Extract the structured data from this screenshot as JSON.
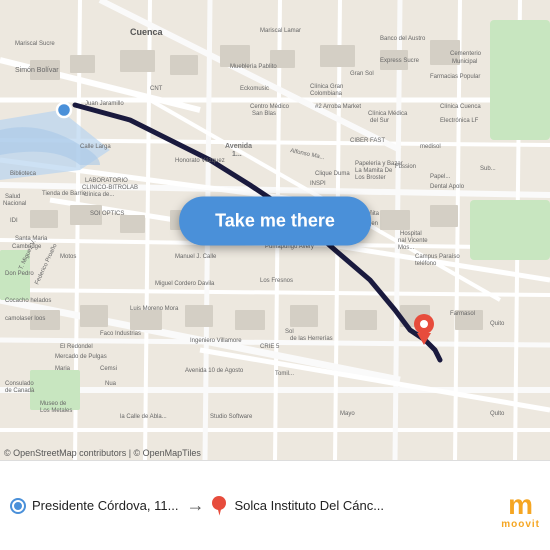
{
  "map": {
    "attribution": "© OpenStreetMap contributors | © OpenMapTiles",
    "route_line_color": "#1a1a2e",
    "accent_blue": "#4a90d9",
    "accent_red": "#e74c3c"
  },
  "button": {
    "label": "Take me there"
  },
  "bottom_bar": {
    "origin_label": "",
    "origin_name": "Presidente Córdova, 11...",
    "dest_label": "",
    "dest_name": "Solca Instituto Del Cánc...",
    "arrow": "→"
  },
  "moovit": {
    "logo_letter": "m",
    "logo_text": "moovit"
  }
}
